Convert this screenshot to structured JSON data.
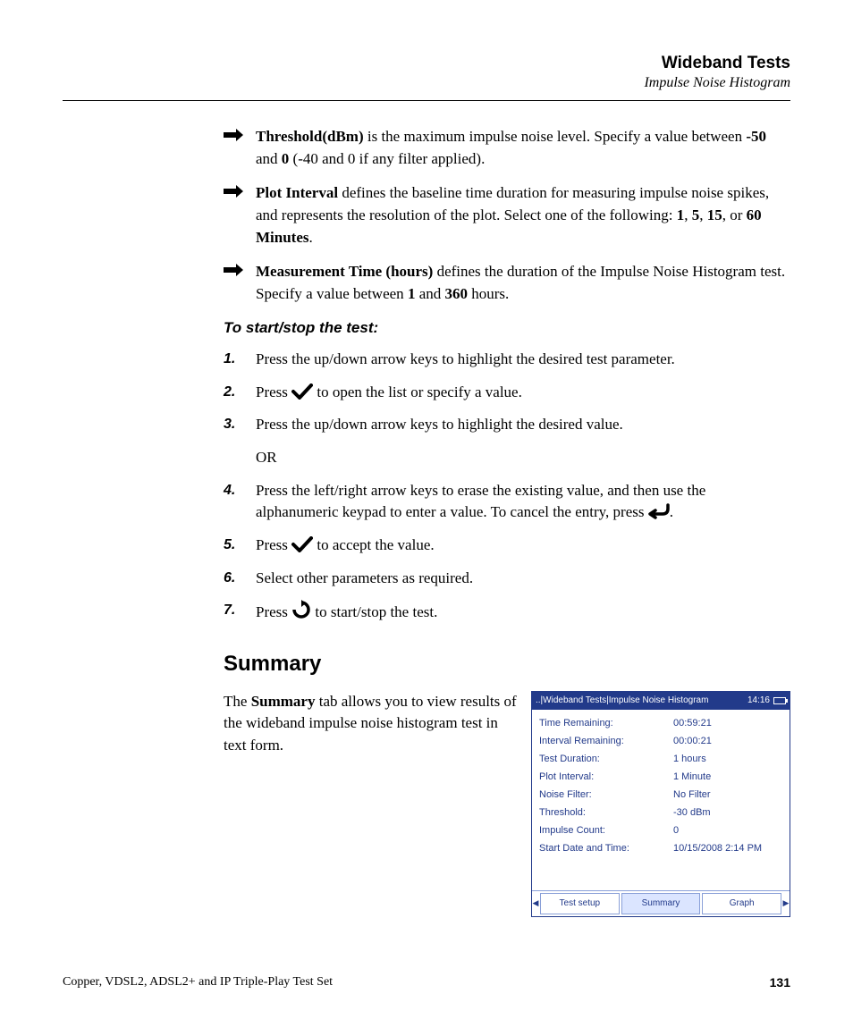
{
  "header": {
    "title": "Wideband Tests",
    "subtitle": "Impulse Noise Histogram"
  },
  "bullets": [
    {
      "lead": "Threshold(dBm)",
      "rest_a": " is the maximum impulse noise level. Specify a value between ",
      "b1": "-50",
      "mid1": " and ",
      "b2": "0",
      "rest_b": " (-40 and 0 if any filter applied)."
    },
    {
      "lead": "Plot Interval",
      "rest_a": " defines the baseline time duration for measuring impulse noise spikes, and represents the resolution of the plot. Select one of the following: ",
      "b1": "1",
      "mid1": ", ",
      "b2": "5",
      "mid2": ", ",
      "b3": "15",
      "mid3": ", or ",
      "b4": "60 Minutes",
      "rest_b": "."
    },
    {
      "lead": "Measurement Time (hours)",
      "rest_a": " defines the duration of the Impulse Noise Histogram test. Specify a value between ",
      "b1": "1",
      "mid1": " and ",
      "b2": "360",
      "rest_b": " hours."
    }
  ],
  "subheading": "To start/stop the test:",
  "steps": {
    "s1": "Press the up/down arrow keys to highlight the desired test parameter.",
    "s2a": "Press ",
    "s2b": " to open the list or specify a value.",
    "s3": "Press the up/down arrow keys to highlight the desired value.",
    "s3or": "OR",
    "s4a": "Press the left/right arrow keys to erase the existing value, and then use the alphanumeric keypad to enter a value. To cancel the entry, press ",
    "s4b": ".",
    "s5a": "Press ",
    "s5b": " to accept the value.",
    "s6": "Select other parameters as required.",
    "s7a": "Press ",
    "s7b": " to start/stop the test."
  },
  "section_heading": "Summary",
  "summary_para_a": "The ",
  "summary_para_bold": "Summary",
  "summary_para_b": " tab allows you to view results of the wideband impulse noise histogram test in text form.",
  "device": {
    "title_path": "..|Wideband Tests|Impulse Noise Histogram",
    "clock": "14:16",
    "rows": [
      {
        "k": "Time Remaining:",
        "v": "00:59:21"
      },
      {
        "k": "Interval Remaining:",
        "v": "00:00:21"
      },
      {
        "k": "Test Duration:",
        "v": "1 hours"
      },
      {
        "k": "Plot Interval:",
        "v": "1 Minute"
      },
      {
        "k": "Noise Filter:",
        "v": "No Filter"
      },
      {
        "k": "Threshold:",
        "v": "-30 dBm"
      },
      {
        "k": "Impulse Count:",
        "v": "0"
      },
      {
        "k": "Start Date and Time:",
        "v": "10/15/2008 2:14 PM"
      }
    ],
    "tabs": {
      "t1": "Test setup",
      "t2": "Summary",
      "t3": "Graph"
    }
  },
  "footer": {
    "left": "Copper, VDSL2, ADSL2+ and IP Triple-Play Test Set",
    "page": "131"
  }
}
